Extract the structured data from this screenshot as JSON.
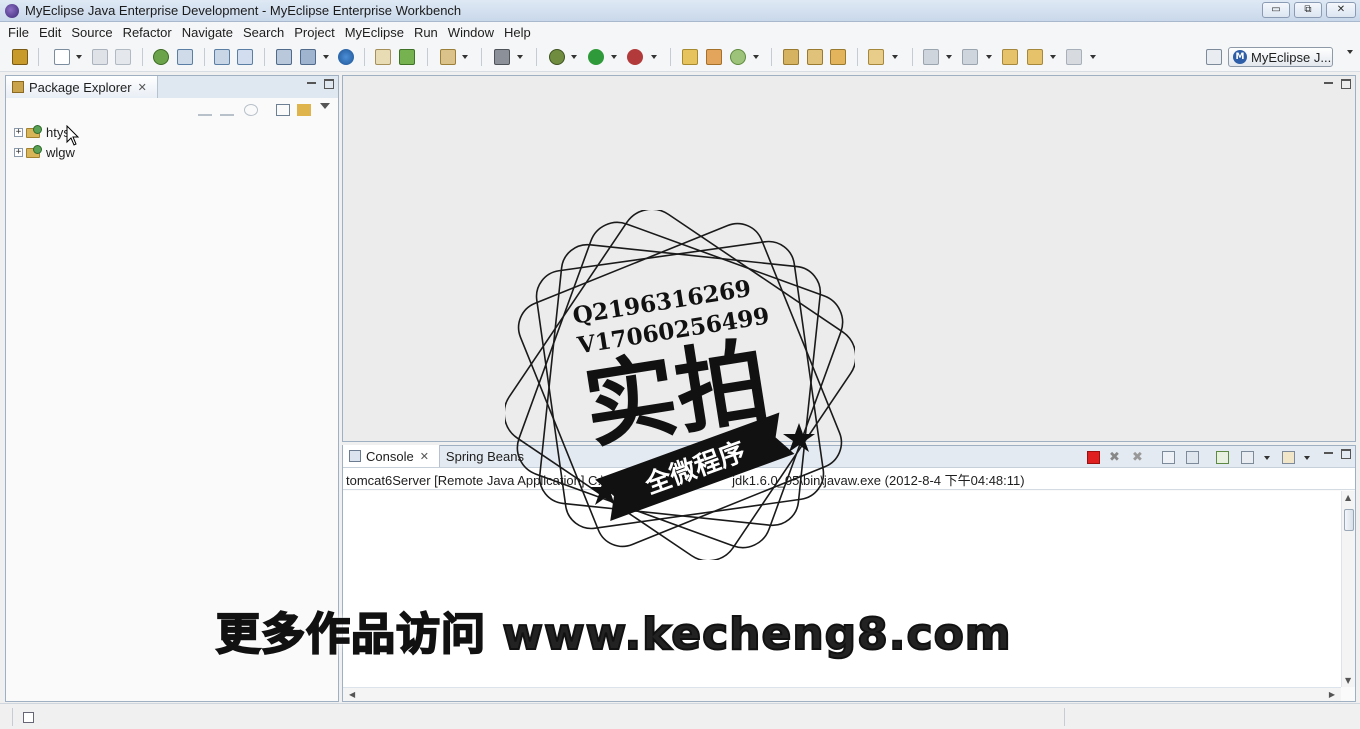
{
  "window": {
    "title": "MyEclipse Java Enterprise Development - MyEclipse Enterprise Workbench",
    "buttons": {
      "minimize": "▭",
      "restore": "⧉",
      "close": "✕"
    }
  },
  "menu": [
    "File",
    "Edit",
    "Source",
    "Refactor",
    "Navigate",
    "Search",
    "Project",
    "MyEclipse",
    "Run",
    "Window",
    "Help"
  ],
  "toolbar": {
    "perspective_label": "MyEclipse J...",
    "perspective_icon": "M"
  },
  "package_explorer": {
    "tab_label": "Package Explorer",
    "projects": [
      {
        "name": "htys",
        "expander": "+"
      },
      {
        "name": "wlgw",
        "expander": "+"
      }
    ]
  },
  "console": {
    "tabs": [
      {
        "label": "Console"
      },
      {
        "label": "Spring Beans"
      }
    ],
    "info": "tomcat6Server [Remote Java Application] C:\\Prog",
    "info_tail": "jdk1.6.0_05\\bin\\javaw.exe (2012-8-4 下午04:48:11)"
  },
  "watermark": {
    "stamp_line1": "Q2196316269",
    "stamp_line2": "V17060256499",
    "stamp_main": "实拍",
    "stamp_ribbon": "全微程序",
    "banner": "更多作品访问 www.kecheng8.com"
  },
  "colors": {
    "stop_red": "#e02020",
    "panel_border": "#9fb0c3",
    "tab_active": "#ffffff"
  }
}
